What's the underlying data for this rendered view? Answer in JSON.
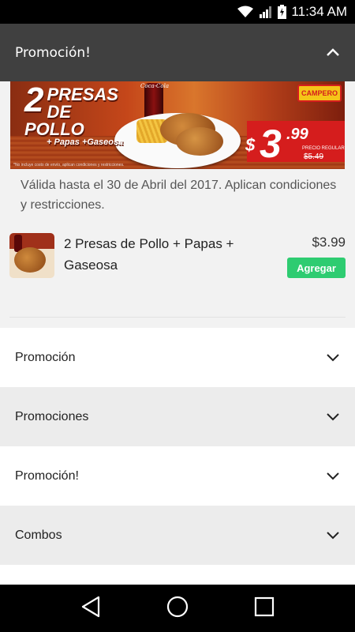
{
  "status_bar": {
    "time": "11:34 AM"
  },
  "header": {
    "title": "Promoción!"
  },
  "banner": {
    "headline_number": "2",
    "headline_line1": "PRESAS",
    "headline_line2": "DE POLLO",
    "headline_line3": "+ Papas +Gaseosa",
    "brand": "CAMPERO",
    "bottle_label": "Coca-Cola",
    "price_currency": "$",
    "price_integer": "3",
    "price_decimal": ".99",
    "regular_label": "PRECIO REGULAR",
    "regular_price": "$5.49",
    "disclaimer": "*No incluye costo de envío, aplican condiciones y restricciones."
  },
  "validity_text": "Válida hasta el 30 de Abril del 2017. Aplican condiciones y restricciones.",
  "product": {
    "name": "2 Presas de Pollo + Papas + Gaseosa",
    "price": "$3.99",
    "add_label": "Agregar"
  },
  "sections": [
    {
      "label": "Promoción"
    },
    {
      "label": "Promociones"
    },
    {
      "label": "Promoción!"
    },
    {
      "label": "Combos"
    }
  ],
  "colors": {
    "header_bg": "#404040",
    "add_button": "#2ecc71",
    "price_band": "#d51d1d"
  }
}
